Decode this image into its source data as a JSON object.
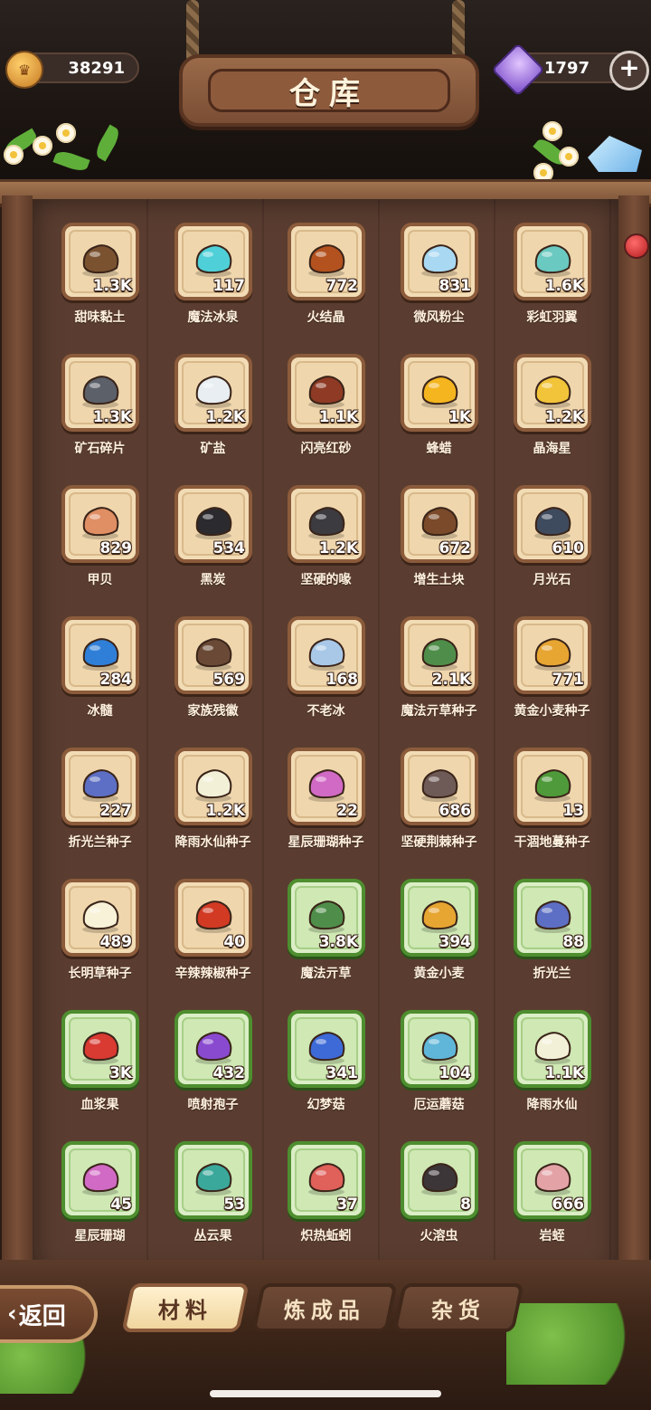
{
  "header": {
    "title": "仓库",
    "coins": "38291",
    "gems": "1797",
    "plus_label": "+"
  },
  "items": [
    {
      "name": "甜味黏土",
      "count": "1.3K",
      "tier": "normal",
      "icon": "clay-icon",
      "color": "#7a5230"
    },
    {
      "name": "魔法冰泉",
      "count": "117",
      "tier": "normal",
      "icon": "spring-icon",
      "color": "#4fd0d8"
    },
    {
      "name": "火结晶",
      "count": "772",
      "tier": "normal",
      "icon": "fire-crystal-icon",
      "color": "#b3521f"
    },
    {
      "name": "微风粉尘",
      "count": "831",
      "tier": "normal",
      "icon": "dust-icon",
      "color": "#a9d8f2"
    },
    {
      "name": "彩虹羽翼",
      "count": "1.6K",
      "tier": "normal",
      "icon": "rainbow-feather-icon",
      "color": "#6ac9c0"
    },
    {
      "name": "矿石碎片",
      "count": "1.3K",
      "tier": "normal",
      "icon": "ore-icon",
      "color": "#5b6069"
    },
    {
      "name": "矿盐",
      "count": "1.2K",
      "tier": "normal",
      "icon": "salt-icon",
      "color": "#e8eef2"
    },
    {
      "name": "闪亮红砂",
      "count": "1.1K",
      "tier": "normal",
      "icon": "red-sand-icon",
      "color": "#8e3a24"
    },
    {
      "name": "蜂蜡",
      "count": "1K",
      "tier": "normal",
      "icon": "beeswax-icon",
      "color": "#f4b51f"
    },
    {
      "name": "晶海星",
      "count": "1.2K",
      "tier": "normal",
      "icon": "starfish-icon",
      "color": "#f2c43a"
    },
    {
      "name": "甲贝",
      "count": "829",
      "tier": "normal",
      "icon": "shell-icon",
      "color": "#e08e64"
    },
    {
      "name": "黑炭",
      "count": "534",
      "tier": "normal",
      "icon": "charcoal-icon",
      "color": "#2b2a2e"
    },
    {
      "name": "坚硬的喙",
      "count": "1.2K",
      "tier": "normal",
      "icon": "beak-icon",
      "color": "#3c3b3f"
    },
    {
      "name": "增生土块",
      "count": "672",
      "tier": "normal",
      "icon": "soil-icon",
      "color": "#7a4a2a"
    },
    {
      "name": "月光石",
      "count": "610",
      "tier": "normal",
      "icon": "moonstone-icon",
      "color": "#3e4a5e"
    },
    {
      "name": "冰髓",
      "count": "284",
      "tier": "normal",
      "icon": "ice-marrow-icon",
      "color": "#2f7fd8"
    },
    {
      "name": "家族残徽",
      "count": "569",
      "tier": "normal",
      "icon": "crest-icon",
      "color": "#6a4a36"
    },
    {
      "name": "不老冰",
      "count": "168",
      "tier": "normal",
      "icon": "eternal-ice-icon",
      "color": "#a9c8e8"
    },
    {
      "name": "魔法亓草种子",
      "count": "2.1K",
      "tier": "normal",
      "icon": "herb-seed-icon",
      "color": "#4f8e4a"
    },
    {
      "name": "黄金小麦种子",
      "count": "771",
      "tier": "normal",
      "icon": "wheat-seed-icon",
      "color": "#e7a532"
    },
    {
      "name": "折光兰种子",
      "count": "227",
      "tier": "normal",
      "icon": "orchid-seed-icon",
      "color": "#5d6fc4"
    },
    {
      "name": "降雨水仙种子",
      "count": "1.2K",
      "tier": "normal",
      "icon": "narcissus-seed-icon",
      "color": "#f3f0d8"
    },
    {
      "name": "星辰珊瑚种子",
      "count": "22",
      "tier": "normal",
      "icon": "coral-seed-icon",
      "color": "#d16ac4"
    },
    {
      "name": "坚硬荆棘种子",
      "count": "686",
      "tier": "normal",
      "icon": "thorn-seed-icon",
      "color": "#6e5a56"
    },
    {
      "name": "干涸地蔓种子",
      "count": "13",
      "tier": "normal",
      "icon": "vine-seed-icon",
      "color": "#4f9a3a"
    },
    {
      "name": "长明草种子",
      "count": "489",
      "tier": "normal",
      "icon": "grass-seed-icon",
      "color": "#f8f2d8"
    },
    {
      "name": "辛辣辣椒种子",
      "count": "40",
      "tier": "normal",
      "icon": "pepper-seed-icon",
      "color": "#d23a24"
    },
    {
      "name": "魔法亓草",
      "count": "3.8K",
      "tier": "green",
      "icon": "herb-icon",
      "color": "#4f8e4a"
    },
    {
      "name": "黄金小麦",
      "count": "394",
      "tier": "green",
      "icon": "wheat-icon",
      "color": "#e7a532"
    },
    {
      "name": "折光兰",
      "count": "88",
      "tier": "green",
      "icon": "orchid-icon",
      "color": "#5d6fc4"
    },
    {
      "name": "血浆果",
      "count": "3K",
      "tier": "green",
      "icon": "berry-icon",
      "color": "#d93a32"
    },
    {
      "name": "喷射孢子",
      "count": "432",
      "tier": "green",
      "icon": "spore-icon",
      "color": "#8a4ad0"
    },
    {
      "name": "幻梦菇",
      "count": "341",
      "tier": "green",
      "icon": "dream-mushroom-icon",
      "color": "#3e6ad8"
    },
    {
      "name": "厄运蘑菇",
      "count": "104",
      "tier": "green",
      "icon": "doom-mushroom-icon",
      "color": "#5fb6d8"
    },
    {
      "name": "降雨水仙",
      "count": "1.1K",
      "tier": "green",
      "icon": "narcissus-icon",
      "color": "#f3f0d8"
    },
    {
      "name": "星辰珊瑚",
      "count": "45",
      "tier": "green",
      "icon": "coral-icon",
      "color": "#d16ac4"
    },
    {
      "name": "丛云果",
      "count": "53",
      "tier": "green",
      "icon": "cloud-fruit-icon",
      "color": "#3aa89a"
    },
    {
      "name": "炽热蚯蚓",
      "count": "37",
      "tier": "green",
      "icon": "worm-icon",
      "color": "#e0605a"
    },
    {
      "name": "火溶虫",
      "count": "8",
      "tier": "green",
      "icon": "lava-bug-icon",
      "color": "#3c3638"
    },
    {
      "name": "岩蛭",
      "count": "666",
      "tier": "green",
      "icon": "rock-leech-icon",
      "color": "#e3a3a6"
    }
  ],
  "tabs": [
    {
      "label": "材料",
      "active": true
    },
    {
      "label": "炼成品",
      "active": false
    },
    {
      "label": "杂货",
      "active": false
    }
  ],
  "back_label": "返回"
}
